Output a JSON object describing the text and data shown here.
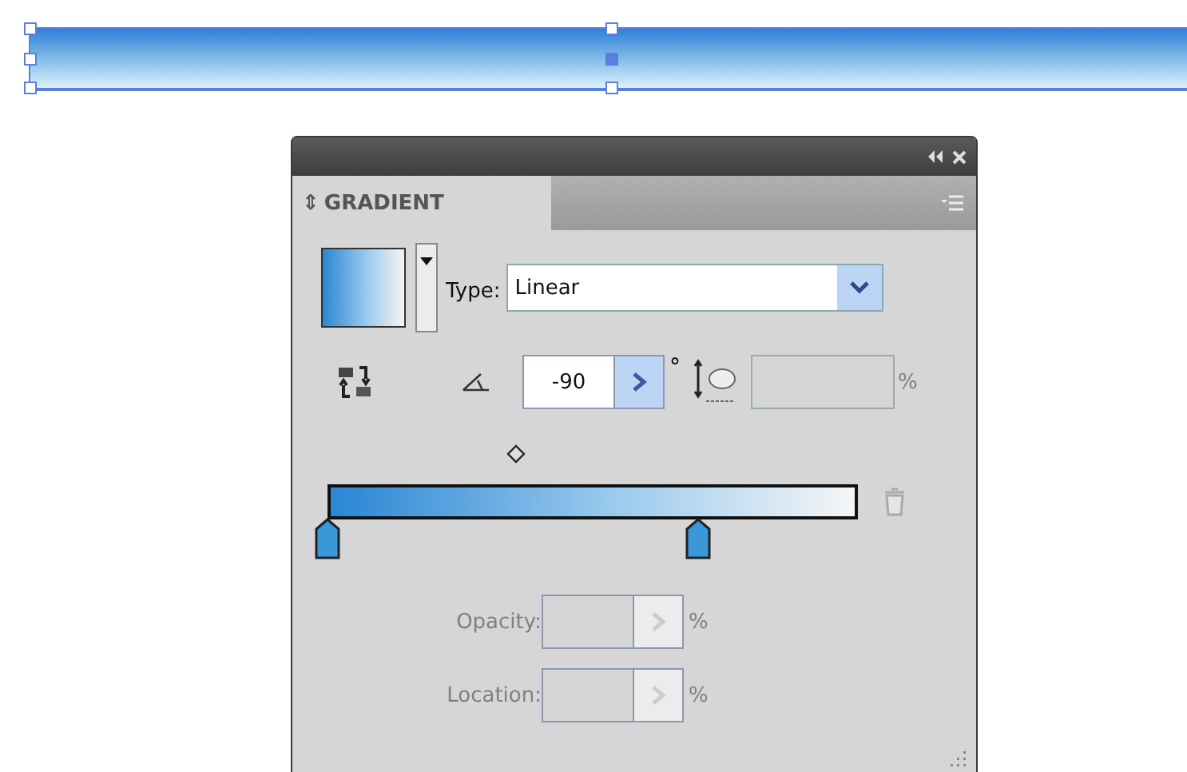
{
  "canvas": {
    "shape": {
      "kind": "picture",
      "selected": true
    }
  },
  "panel": {
    "tab": {
      "label": "GRADIENT",
      "arrows": "⇕"
    },
    "type": {
      "label": "Type:",
      "value": "Linear"
    },
    "angle": {
      "value": "-90",
      "unit": "°"
    },
    "aspect": {
      "unit": "%",
      "disabled": true
    },
    "midpoint": {
      "level": 0.35
    },
    "stops": [
      {
        "level": 0
      },
      {
        "level": 0.7
      }
    ],
    "fields": [
      {
        "label": "Opacity:",
        "unit": "%",
        "disabled": true
      },
      {
        "label": "Location:",
        "unit": "%",
        "disabled": true
      }
    ]
  }
}
